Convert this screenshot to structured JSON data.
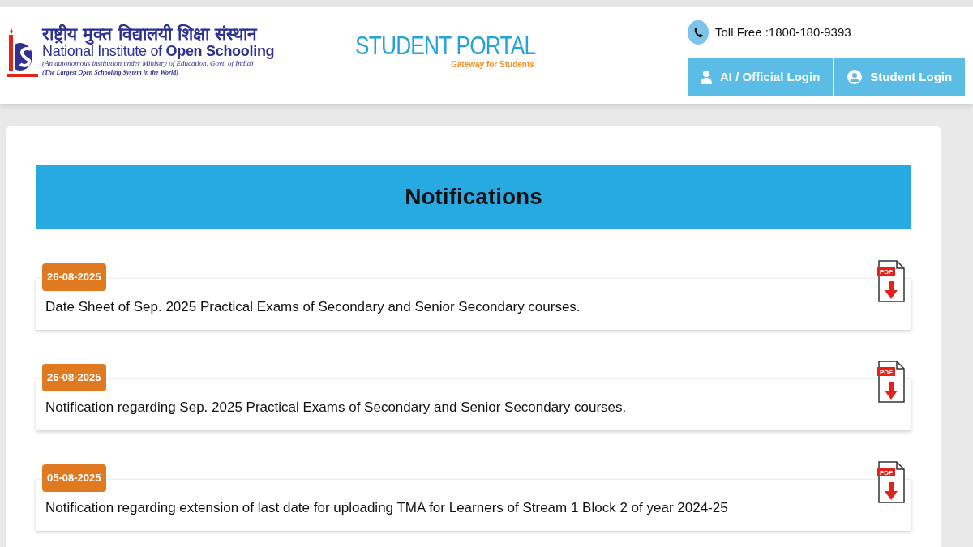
{
  "header": {
    "logo_hindi": "राष्ट्रीय मुक्त विद्यालयी शिक्षा संस्थान",
    "logo_english_regular": "National Institute of ",
    "logo_english_bold": "Open Schooling",
    "logo_subtitle": "(An autonomous institution under Ministry of Education, Govt. of India)",
    "logo_tagline": "(The Largest Open Schooling System in the World)",
    "portal_title": "STUDENT PORTAL",
    "portal_subtitle": "Gateway for Students",
    "toll_free": "Toll Free :1800-180-9393",
    "buttons": [
      {
        "label": "AI / Official Login",
        "kind": "official"
      },
      {
        "label": "Student Login",
        "kind": "student"
      }
    ]
  },
  "section_title": "Notifications",
  "notifications": [
    {
      "date": "26-08-2025",
      "text": "Date Sheet of Sep. 2025 Practical Exams of Secondary and Senior Secondary courses.",
      "file_label": "PDF"
    },
    {
      "date": "26-08-2025",
      "text": "Notification regarding Sep. 2025 Practical Exams of Secondary and Senior Secondary courses.",
      "file_label": "PDF"
    },
    {
      "date": "05-08-2025",
      "text": "Notification regarding extension of last date for uploading TMA for Learners of Stream 1 Block 2 of year 2024-25",
      "file_label": "PDF"
    }
  ]
}
